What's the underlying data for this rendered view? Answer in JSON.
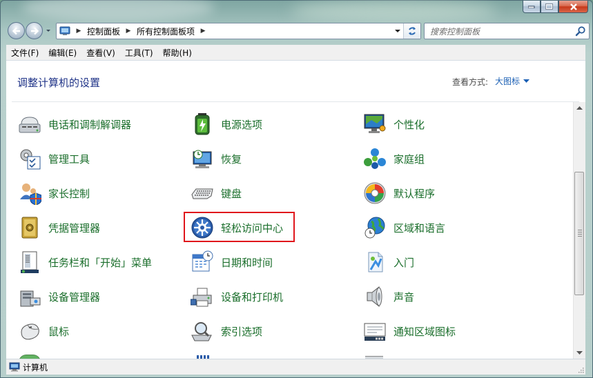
{
  "window": {
    "caption_buttons": [
      "minimize",
      "maximize",
      "close"
    ]
  },
  "address": {
    "crumbs": [
      "控制面板",
      "所有控制面板项"
    ]
  },
  "search": {
    "placeholder": "搜索控制面板"
  },
  "menu": [
    "文件(F)",
    "编辑(E)",
    "查看(V)",
    "工具(T)",
    "帮助(H)"
  ],
  "content": {
    "heading": "调整计算机的设置",
    "view_by_label": "查看方式:",
    "view_by_value": "大图标",
    "items": [
      {
        "label": "电话和调制解调器",
        "icon": "phone-modem-icon"
      },
      {
        "label": "电源选项",
        "icon": "battery-icon"
      },
      {
        "label": "个性化",
        "icon": "personalization-icon"
      },
      {
        "label": "管理工具",
        "icon": "admin-tools-icon"
      },
      {
        "label": "恢复",
        "icon": "recovery-icon"
      },
      {
        "label": "家庭组",
        "icon": "homegroup-icon"
      },
      {
        "label": "家长控制",
        "icon": "parental-control-icon"
      },
      {
        "label": "键盘",
        "icon": "keyboard-icon"
      },
      {
        "label": "默认程序",
        "icon": "default-programs-icon"
      },
      {
        "label": "凭据管理器",
        "icon": "credential-manager-icon"
      },
      {
        "label": "轻松访问中心",
        "icon": "ease-of-access-icon"
      },
      {
        "label": "区域和语言",
        "icon": "globe-clock-icon"
      },
      {
        "label": "任务栏和「开始」菜单",
        "icon": "taskbar-icon"
      },
      {
        "label": "日期和时间",
        "icon": "calendar-clock-icon"
      },
      {
        "label": "入门",
        "icon": "getting-started-icon"
      },
      {
        "label": "设备管理器",
        "icon": "device-manager-icon"
      },
      {
        "label": "设备和打印机",
        "icon": "printer-icon"
      },
      {
        "label": "声音",
        "icon": "speaker-icon"
      },
      {
        "label": "鼠标",
        "icon": "mouse-icon"
      },
      {
        "label": "索引选项",
        "icon": "indexing-icon"
      },
      {
        "label": "通知区域图标",
        "icon": "notification-icons-icon"
      }
    ],
    "highlighted_item": "轻松访问中心",
    "colors": {
      "item_text": "#1a6e2b",
      "heading": "#1e3287",
      "link": "#1a5fb4",
      "highlight": "#e0151b"
    }
  },
  "status": {
    "text": "计算机"
  }
}
